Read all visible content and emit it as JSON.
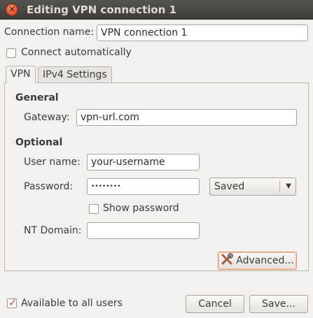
{
  "window": {
    "title": "Editing VPN connection 1"
  },
  "connection_name": {
    "label": "Connection name:",
    "value": "VPN connection 1"
  },
  "connect_automatically": {
    "label": "Connect automatically",
    "checked": false
  },
  "tabs": [
    {
      "label": "VPN",
      "active": true
    },
    {
      "label": "IPv4 Settings",
      "active": false
    }
  ],
  "general": {
    "heading": "General",
    "gateway_label": "Gateway:",
    "gateway_value": "vpn-url.com"
  },
  "optional": {
    "heading": "Optional",
    "username_label": "User name:",
    "username_value": "your-username",
    "password_label": "Password:",
    "password_value": "••••••••",
    "password_storage": "Saved",
    "show_password_label": "Show password",
    "show_password_checked": false,
    "nt_domain_label": "NT Domain:",
    "nt_domain_value": ""
  },
  "advanced_button": {
    "label": "Advanced..."
  },
  "available_to_all": {
    "label": "Available to all users",
    "checked": true
  },
  "footer": {
    "cancel_label": "Cancel",
    "save_label": "Save..."
  },
  "colors": {
    "accent": "#e0542b",
    "titlebar": "#3d3c38",
    "background": "#f2f1f0"
  }
}
